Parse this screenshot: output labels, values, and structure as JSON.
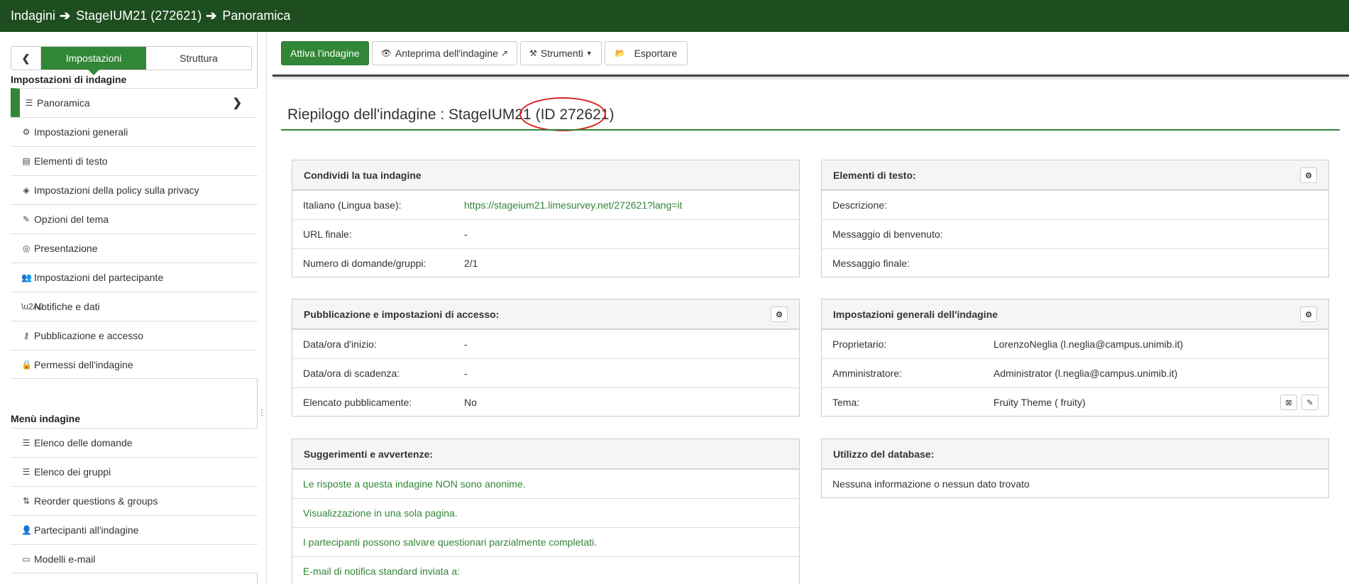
{
  "breadcrumb": {
    "items": [
      "Indagini",
      "StageIUM21 (272621)",
      "Panoramica"
    ]
  },
  "sidebar": {
    "tabs": {
      "settings": "Impostazioni",
      "structure": "Struttura"
    },
    "settings_heading": "Impostazioni di indagine",
    "settings_items": [
      {
        "label": "Panoramica",
        "icon": "list-icon"
      },
      {
        "label": "Impostazioni generali",
        "icon": "gears-icon"
      },
      {
        "label": "Elementi di testo",
        "icon": "file-text-icon"
      },
      {
        "label": "Impostazioni della policy sulla privacy",
        "icon": "shield-icon"
      },
      {
        "label": "Opzioni del tema",
        "icon": "paint-brush-icon"
      },
      {
        "label": "Presentazione",
        "icon": "eye-slash-icon"
      },
      {
        "label": "Impostazioni del partecipante",
        "icon": "users-icon"
      },
      {
        "label": "Notifiche e dati",
        "icon": "rss-icon"
      },
      {
        "label": "Pubblicazione e accesso",
        "icon": "key-icon"
      },
      {
        "label": "Permessi dell'indagine",
        "icon": "lock-icon"
      }
    ],
    "menu_heading": "Menù indagine",
    "menu_items": [
      {
        "label": "Elenco delle domande",
        "icon": "list-icon"
      },
      {
        "label": "Elenco dei gruppi",
        "icon": "list-icon"
      },
      {
        "label": "Reorder questions & groups",
        "icon": "sort-icon"
      },
      {
        "label": "Partecipanti all'indagine",
        "icon": "user-icon"
      },
      {
        "label": "Modelli e-mail",
        "icon": "window-icon"
      }
    ]
  },
  "toolbar": {
    "activate": "Attiva l'indagine",
    "preview": "Anteprima dell'indagine",
    "tools": "Strumenti",
    "export": "Esportare"
  },
  "title": {
    "prefix": "Riepilogo dell'indagine : StageIUM21 ",
    "id_text": "(ID 272621)"
  },
  "panels": {
    "share": {
      "title": "Condividi la tua indagine",
      "rows": [
        {
          "k": "Italiano (Lingua base):",
          "v": "https://stageium21.limesurvey.net/272621?lang=it"
        },
        {
          "k": "URL finale:",
          "v": "-"
        },
        {
          "k": "Numero di domande/gruppi:",
          "v": "2/1"
        }
      ]
    },
    "text_elements": {
      "title": "Elementi di testo:",
      "rows": [
        {
          "k": "Descrizione:",
          "v": ""
        },
        {
          "k": "Messaggio di benvenuto:",
          "v": ""
        },
        {
          "k": "Messaggio finale:",
          "v": ""
        }
      ]
    },
    "publication": {
      "title": "Pubblicazione e impostazioni di accesso:",
      "rows": [
        {
          "k": "Data/ora d'inizio:",
          "v": "-"
        },
        {
          "k": "Data/ora di scadenza:",
          "v": "-"
        },
        {
          "k": "Elencato pubblicamente:",
          "v": "No"
        }
      ]
    },
    "general": {
      "title": "Impostazioni generali dell'indagine",
      "rows": [
        {
          "k": "Proprietario:",
          "v": "LorenzoNeglia (l.neglia@campus.unimib.it)"
        },
        {
          "k": "Amministratore:",
          "v": "Administrator (l.neglia@campus.unimib.it)"
        },
        {
          "k": "Tema:",
          "v": "Fruity Theme ( fruity)"
        }
      ]
    },
    "hints": {
      "title": "Suggerimenti e avvertenze:",
      "rows": [
        "Le risposte a questa indagine NON sono anonime.",
        "Visualizzazione in una sola pagina.",
        "I partecipanti possono salvare questionari parzialmente completati.",
        "E-mail di notifica standard inviata a:"
      ]
    },
    "database": {
      "title": "Utilizzo del database:",
      "rows": [
        "Nessuna informazione o nessun dato trovato"
      ]
    }
  },
  "colors": {
    "brand": "#328637",
    "topbar": "#1e4d20",
    "annotation": "#d9201e"
  }
}
